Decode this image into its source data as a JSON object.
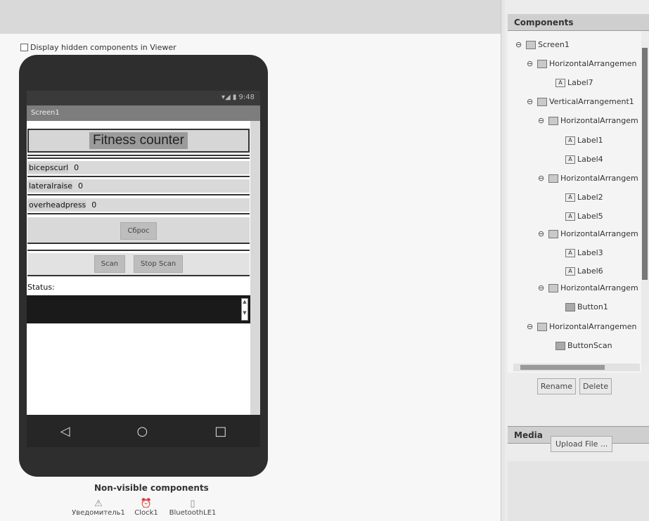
{
  "viewer": {
    "hidden_toggle_label": "Display hidden components in Viewer",
    "status_time": "9:48",
    "screen_title": "Screen1",
    "app_title": "Fitness counter",
    "rows": [
      {
        "label": "bicepscurl",
        "value": "0"
      },
      {
        "label": "lateralraise",
        "value": "0"
      },
      {
        "label": "overheadpress",
        "value": "0"
      }
    ],
    "reset_button": "Сброс",
    "scan_button": "Scan",
    "stop_scan_button": "Stop Scan",
    "status_label": "Status:",
    "nav": {
      "back": "◁",
      "home": "○",
      "recent": "□"
    },
    "nonvisible_title": "Non-visible components",
    "nonvisible": [
      "Уведомитель1",
      "Clock1",
      "BluetoothLE1"
    ]
  },
  "components": {
    "title": "Components",
    "tree": [
      {
        "label": "Screen1",
        "toggle": "⊖",
        "kind": "screen"
      },
      {
        "label": "HorizontalArrangemen",
        "toggle": "⊖",
        "kind": "arr"
      },
      {
        "label": "Label7",
        "toggle": "",
        "kind": "lbl"
      },
      {
        "label": "VerticalArrangement1",
        "toggle": "⊖",
        "kind": "arr"
      },
      {
        "label": "HorizontalArrangem",
        "toggle": "⊖",
        "kind": "arr"
      },
      {
        "label": "Label1",
        "toggle": "",
        "kind": "lbl"
      },
      {
        "label": "Label4",
        "toggle": "",
        "kind": "lbl"
      },
      {
        "label": "HorizontalArrangem",
        "toggle": "⊖",
        "kind": "arr"
      },
      {
        "label": "Label2",
        "toggle": "",
        "kind": "lbl"
      },
      {
        "label": "Label5",
        "toggle": "",
        "kind": "lbl"
      },
      {
        "label": "HorizontalArrangem",
        "toggle": "⊖",
        "kind": "arr"
      },
      {
        "label": "Label3",
        "toggle": "",
        "kind": "lbl"
      },
      {
        "label": "Label6",
        "toggle": "",
        "kind": "lbl"
      },
      {
        "label": "HorizontalArrangem",
        "toggle": "⊖",
        "kind": "arr"
      },
      {
        "label": "Button1",
        "toggle": "",
        "kind": "btn"
      },
      {
        "label": "HorizontalArrangemen",
        "toggle": "⊖",
        "kind": "arr"
      },
      {
        "label": "ButtonScan",
        "toggle": "",
        "kind": "btn"
      }
    ],
    "rename_button": "Rename",
    "delete_button": "Delete"
  },
  "media": {
    "title": "Media",
    "upload_button": "Upload File ..."
  },
  "colors": {
    "background": "#ececec",
    "phone_body": "#2e2e2e",
    "title_bar": "#7d7d7d"
  }
}
